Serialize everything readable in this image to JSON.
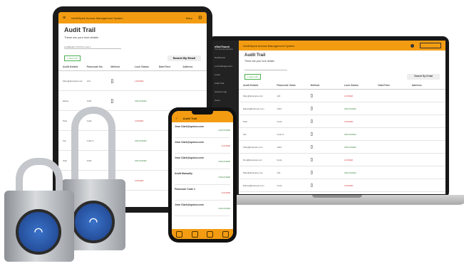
{
  "tablet": {
    "app_title": "IntelliSpark Access Management System",
    "user": "Mary",
    "page_title": "Audit Trail",
    "subtitle": "These are your lock details",
    "dropdown": "LockBuddy 1 M Pros Lock 1",
    "add_button": "+ Add Lock",
    "search_label": "Search By Email",
    "columns": [
      "Audit Details",
      "Passcode No.",
      "Method",
      "Lock Status",
      "Date/Time",
      "Address"
    ],
    "rows": [
      {
        "user": "Mary@Example.com",
        "code": "123",
        "status": "LOCKED",
        "status_color": "#d32f2f"
      },
      {
        "user": "Elaine",
        "code": "1234",
        "status": "UNLOCKED",
        "status_color": "#2e7d32"
      },
      {
        "user": "Paul",
        "code": "Code",
        "status": "LOCKED",
        "status_color": "#d32f2f"
      },
      {
        "user": "Kim",
        "code": "Code 5",
        "status": "UNLOCKED",
        "status_color": "#2e7d32"
      },
      {
        "user": "Stan",
        "code": "1234",
        "status": "UNLOCKED",
        "status_color": "#2e7d32"
      },
      {
        "user": "Ron",
        "code": "Code",
        "status": "LOCKED",
        "status_color": "#d32f2f"
      }
    ]
  },
  "laptop": {
    "brand": "eSeeTouch",
    "brand_sub": "Your Security Solutions",
    "app_title": "IntelliSpark Access Management System",
    "page_title": "Audit Trail",
    "subtitle": "These are your lock details",
    "add_button": "+ Add Lock",
    "search_label": "Search By Email",
    "sidebar": [
      "Dashboard",
      "Lock Management",
      "Locks",
      "Audit Trail",
      "Access Logs",
      "Users",
      "Groups",
      "Reports",
      "Settings"
    ],
    "columns": [
      "Audit Details",
      "Passcode Value",
      "Method",
      "Lock Status",
      "Date/Time",
      "Address"
    ],
    "rows": [
      {
        "user": "Mary@Example.com",
        "code": "123",
        "status": "LOCKED",
        "status_color": "#d32f2f"
      },
      {
        "user": "Elaine@Example.com",
        "code": "1234",
        "status": "UNLOCKED",
        "status_color": "#2e7d32"
      },
      {
        "user": "Paul",
        "code": "Code",
        "status": "LOCKED",
        "status_color": "#d32f2f"
      },
      {
        "user": "Kim",
        "code": "Code 5",
        "status": "UNLOCKED",
        "status_color": "#2e7d32"
      },
      {
        "user": "Stan@Example.com",
        "code": "1234",
        "status": "UNLOCKED",
        "status_color": "#2e7d32"
      },
      {
        "user": "Ron@Example.com",
        "code": "Code",
        "status": "LOCKED",
        "status_color": "#d32f2f"
      },
      {
        "user": "Mary@Example.com",
        "code": "123",
        "status": "UNLOCKED",
        "status_color": "#2e7d32"
      },
      {
        "user": "Elaine@Example.com",
        "code": "Code",
        "status": "LOCKED",
        "status_color": "#d32f2f"
      }
    ]
  },
  "phone": {
    "title": "Audit Trail",
    "cards": [
      {
        "head": "Jean Clark@upsiou.com",
        "status": "UNLOCKED",
        "status_color": "#2e7d32"
      },
      {
        "head": "Jean Clark@upsiou.com",
        "status": "LOCKED",
        "status_color": "#d32f2f"
      },
      {
        "head": "Jean Clark@upsiou.com",
        "status": "UNLOCKED",
        "status_color": "#2e7d32"
      },
      {
        "head": "Audit Manually",
        "status": "UNLOCKED",
        "status_color": "#2e7d32"
      },
      {
        "head": "Passcode Code 1",
        "status": "LOCKED",
        "status_color": "#d32f2f"
      },
      {
        "head": "Jean Clark@upsiou.com",
        "status": "UNLOCKED",
        "status_color": "#2e7d32"
      }
    ]
  },
  "accent_color": "#f39c12",
  "icons": [
    "padlock",
    "wifi-icon",
    "home-icon",
    "list-icon",
    "user-icon",
    "gear-icon"
  ]
}
